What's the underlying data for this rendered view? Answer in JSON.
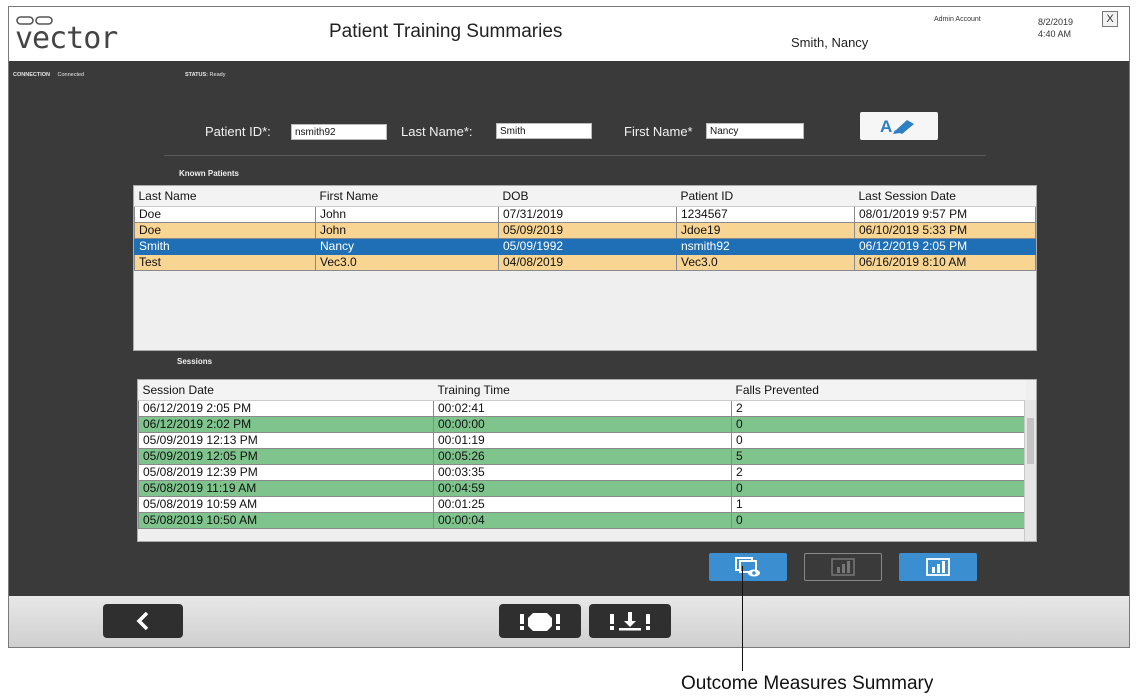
{
  "header": {
    "logo_text": "vector",
    "title": "Patient Training Summaries",
    "patient_name": "Smith, Nancy",
    "account": "Admin Account",
    "date": "8/2/2019",
    "time": "4:40 AM",
    "close_label": "X"
  },
  "status": {
    "connection_label": "CONNECTION",
    "connection_value": "Connected",
    "status_label": "STATUS:",
    "status_value": "Ready"
  },
  "form": {
    "patient_id_label": "Patient ID*:",
    "patient_id_value": "nsmith92",
    "last_name_label": "Last Name*:",
    "last_name_value": "Smith",
    "first_name_label": "First Name*",
    "first_name_value": "Nancy"
  },
  "known_patients": {
    "title": "Known Patients",
    "columns": [
      "Last Name",
      "First Name",
      "DOB",
      "Patient ID",
      "Last Session Date"
    ],
    "rows": [
      {
        "cells": [
          "Doe",
          "John",
          "07/31/2019",
          "1234567",
          "08/01/2019 9:57 PM"
        ],
        "style": "white"
      },
      {
        "cells": [
          "Doe",
          "John",
          "05/09/2019",
          "Jdoe19",
          "06/10/2019 5:33 PM"
        ],
        "style": "yellow"
      },
      {
        "cells": [
          "Smith",
          "Nancy",
          "05/09/1992",
          "nsmith92",
          "06/12/2019 2:05 PM"
        ],
        "style": "selected"
      },
      {
        "cells": [
          "Test",
          "Vec3.0",
          "04/08/2019",
          "Vec3.0",
          "06/16/2019 8:10 AM"
        ],
        "style": "yellow"
      }
    ]
  },
  "sessions": {
    "title": "Sessions",
    "columns": [
      "Session Date",
      "Training Time",
      "Falls Prevented"
    ],
    "rows": [
      {
        "cells": [
          "06/12/2019 2:05 PM",
          "00:02:41",
          "2"
        ],
        "style": "white"
      },
      {
        "cells": [
          "06/12/2019 2:02 PM",
          "00:00:00",
          "0"
        ],
        "style": "green"
      },
      {
        "cells": [
          "05/09/2019 12:13 PM",
          "00:01:19",
          "0"
        ],
        "style": "white"
      },
      {
        "cells": [
          "05/09/2019 12:05 PM",
          "00:05:26",
          "5"
        ],
        "style": "green"
      },
      {
        "cells": [
          "05/08/2019 12:39 PM",
          "00:03:35",
          "2"
        ],
        "style": "white"
      },
      {
        "cells": [
          "05/08/2019 11:19 AM",
          "00:04:59",
          "0"
        ],
        "style": "green"
      },
      {
        "cells": [
          "05/08/2019 10:59 AM",
          "00:01:25",
          "1"
        ],
        "style": "white"
      },
      {
        "cells": [
          "05/08/2019 10:50 AM",
          "00:00:04",
          "0"
        ],
        "style": "green"
      }
    ]
  },
  "buttons": {
    "outcome_summary_icon": "monitor-eye-icon",
    "report_disabled_icon": "bar-chart-icon",
    "report_icon": "bar-chart-icon",
    "back_icon": "chevron-left-icon",
    "alert_icon": "fall-alert-icon",
    "training_icon": "floor-alert-icon"
  },
  "callout": {
    "text": "Outcome Measures Summary"
  },
  "colors": {
    "panel": "#3a3a3a",
    "selected_row": "#1f6fb6",
    "yellow_row": "#f8d592",
    "green_row": "#7ec48c",
    "accent_button": "#3b8fd0"
  }
}
